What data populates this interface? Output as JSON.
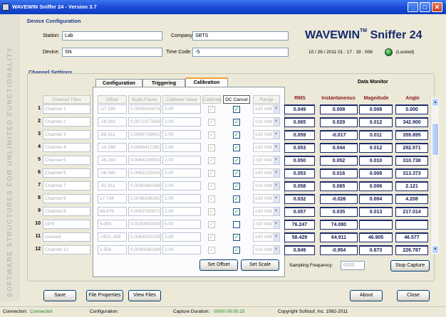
{
  "window": {
    "title": "WAVEWIN Sniffer 24 - Version 3.7",
    "minimize": "_",
    "maximize": "□",
    "close": "✕"
  },
  "sidebar_text": "SOFTWARE STRUCTURES FOR UNLIMITED FUNCTIONALITY",
  "device_config": {
    "header": "Device Configuration",
    "station_label": "Station:",
    "station_value": "Lab",
    "company_label": "Company:",
    "company_value": "SBTS",
    "device_label": "Device:",
    "device_value": "SN",
    "timecode_label": "Time Code:",
    "timecode_value": "-5"
  },
  "brand": {
    "name": "WAVEWIN",
    "tm": "TM",
    "product": "Sniffer 24",
    "timestamp": "10 / 26 / 2011  01 : 17 : 18 . 008",
    "lock_status": "(Locked)"
  },
  "channel_settings": {
    "header": "Channel Settings",
    "tabs": [
      "Configuration",
      "Triggering",
      "Calibration"
    ],
    "active_tab": "Calibration",
    "col_headers": [
      "Channel Titles",
      "Offset",
      "Scale Factor",
      "Calibrate Value",
      "Calibrate",
      "DC Cancel",
      "Range"
    ],
    "set_offset_label": "Set Offset",
    "set_scale_label": "Set Scale"
  },
  "data_monitor": {
    "header": "Data Monitor",
    "col_headers": [
      "RMS",
      "Instantaneous",
      "Magnitude",
      "Angle"
    ]
  },
  "channels": [
    {
      "num": "1",
      "title": "Channel 1",
      "offset": "-27.299",
      "scale": "0.0058343074",
      "calib": "2.00",
      "dc": true,
      "range": "±10 Volt",
      "rms": "0.049",
      "inst": "0.008",
      "mag": "0.008",
      "angle": "0.000"
    },
    {
      "num": "2",
      "title": "Channel 2",
      "offset": "-18.991",
      "scale": "0.0072377658",
      "calib": "2.00",
      "dc": true,
      "range": "±10 Volt",
      "rms": "0.065",
      "inst": "0.029",
      "mag": "0.012",
      "angle": "342.900"
    },
    {
      "num": "3",
      "title": "Channel 3",
      "offset": "-58.511",
      "scale": "0.0066726601",
      "calib": "2.00",
      "dc": true,
      "range": "±10 Volt",
      "rms": "0.059",
      "inst": "-0.017",
      "mag": "0.011",
      "angle": "359.895"
    },
    {
      "num": "4",
      "title": "Channel 4",
      "offset": "-14.268",
      "scale": "0.0068417381",
      "calib": "2.00",
      "dc": true,
      "range": "±10 Volt",
      "rms": "0.053",
      "inst": "0.044",
      "mag": "0.012",
      "angle": "292.571"
    },
    {
      "num": "5",
      "title": "Channel 5",
      "offset": "-35.160",
      "scale": "0.0064108953",
      "calib": "2.00",
      "dc": true,
      "range": "±10 Volt",
      "rms": "0.050",
      "inst": "0.052",
      "mag": "0.010",
      "angle": "310.738"
    },
    {
      "num": "6",
      "title": "Channel 6",
      "offset": "-26.580",
      "scale": "0.0062223416",
      "calib": "2.00",
      "dc": true,
      "range": "±10 Volt",
      "rms": "0.053",
      "inst": "0.016",
      "mag": "0.008",
      "angle": "313.373"
    },
    {
      "num": "7",
      "title": "Channel 7",
      "offset": "-31.911",
      "scale": "0.0065491568",
      "calib": "2.00",
      "dc": true,
      "range": "±10 Volt",
      "rms": "0.058",
      "inst": "0.065",
      "mag": "0.006",
      "angle": "2.121"
    },
    {
      "num": "8",
      "title": "Channel 8",
      "offset": "17.734",
      "scale": "0.0036306391",
      "calib": "2.00",
      "dc": true,
      "range": "±10 Volt",
      "rms": "0.032",
      "inst": "-0.026",
      "mag": "0.004",
      "angle": "4.208"
    },
    {
      "num": "9",
      "title": "Channel 9",
      "offset": "68.476",
      "scale": "0.0062783672",
      "calib": "2.00",
      "dc": true,
      "range": "±10 Volt",
      "rms": "0.057",
      "inst": "0.035",
      "mag": "0.013",
      "angle": "217.014"
    },
    {
      "num": "10",
      "title": "GPS",
      "offset": "5.000",
      "scale": "0.0100000000",
      "calib": "5.00",
      "dc": false,
      "range": "±10 Volt",
      "rms": "76.247",
      "inst": "74.080",
      "mag": "",
      "angle": ""
    },
    {
      "num": "11",
      "title": "Unused",
      "offset": "-2921.358",
      "scale": "0.0063251319",
      "calib": "2.00",
      "dc": true,
      "range": "±10 Volt",
      "rms": "58.429",
      "inst": "64.911",
      "mag": "46.905",
      "angle": "46.577"
    },
    {
      "num": "12",
      "title": "Channel 12",
      "offset": "1.558",
      "scale": "0.0065590289",
      "calib": "2.00",
      "dc": true,
      "range": "±10 Volt",
      "rms": "0.849",
      "inst": "-0.954",
      "mag": "0.673",
      "angle": "226.787"
    }
  ],
  "sampling": {
    "label": "Sampling Frequency:",
    "value": "6000"
  },
  "stop_capture_label": "Stop Capture",
  "bottom_buttons": {
    "save": "Save",
    "file_properties": "File Properties",
    "view_files": "View Files",
    "about": "About",
    "close": "Close"
  },
  "statusbar": {
    "connection_label": "Connection:",
    "connection_value": "Connected",
    "configuration_label": "Configuration:",
    "duration_label": "Capture Duration:",
    "duration_value": "00/00  00:00:15",
    "copyright": "Copyright Softstuf, Inc. 1992-2011"
  },
  "colors": {
    "title_blue": "#1f4fd6",
    "header_blue": "#1b3a8c",
    "monitor_red": "#8b1a1a",
    "value_navy": "#141a55",
    "status_green": "#1a8a1a"
  }
}
